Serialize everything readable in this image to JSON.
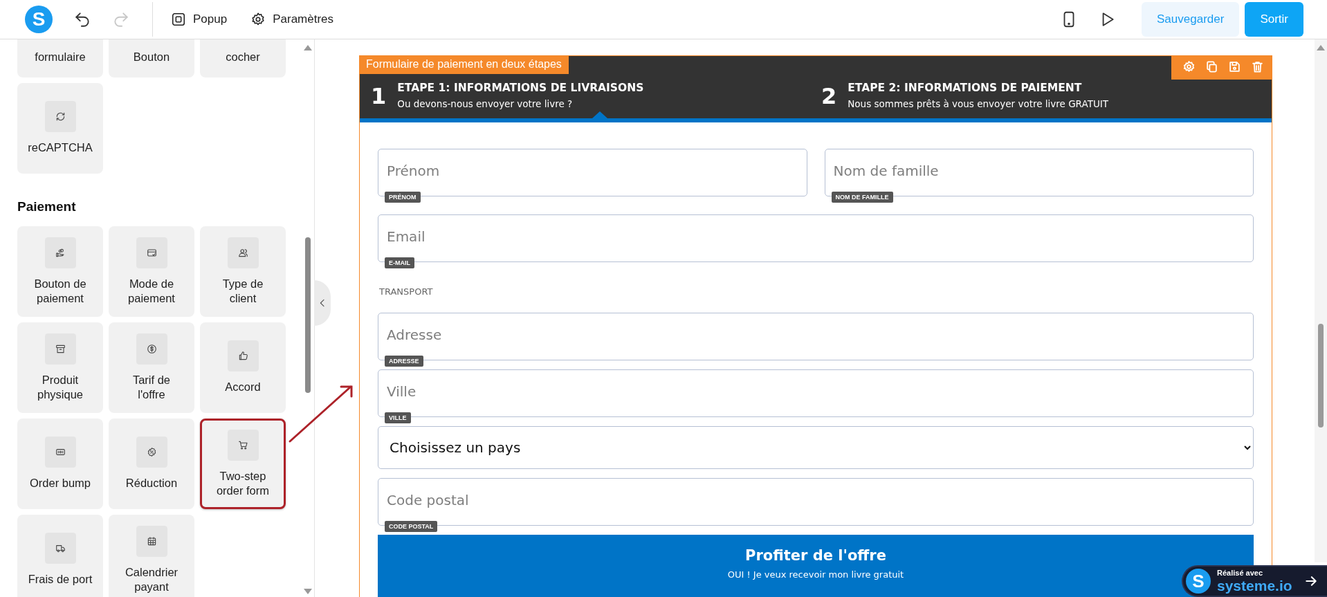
{
  "app": {
    "logo": "S"
  },
  "toolbar": {
    "history": [
      {
        "kind": "undo",
        "disabled": false
      },
      {
        "kind": "redo",
        "disabled": true
      }
    ],
    "menu": [
      {
        "label": "Popup",
        "kind": "popup"
      },
      {
        "label": "Paramètres",
        "kind": "gear"
      }
    ],
    "tools": [
      {
        "kind": "mobile"
      },
      {
        "kind": "play"
      }
    ],
    "buttons": [
      {
        "label": "Sauvegarder",
        "kind": "secondary"
      },
      {
        "label": "Sortir",
        "kind": "primary"
      }
    ]
  },
  "sidebar": {
    "sections": [
      {
        "items": [
          {
            "label": "formulaire",
            "highlighted": false
          },
          {
            "label": "Bouton",
            "highlighted": false
          },
          {
            "label": "cocher",
            "highlighted": false
          },
          {
            "label": "reCAPTCHA",
            "kind": "refresh",
            "highlighted": false
          }
        ]
      },
      {
        "title": "Paiement",
        "items": [
          {
            "label": "Bouton de\npaiement",
            "kind": "coins-hand",
            "highlighted": false
          },
          {
            "label": "Mode de\npaiement",
            "kind": "card",
            "highlighted": false
          },
          {
            "label": "Type de\nclient",
            "kind": "users",
            "highlighted": false
          },
          {
            "label": "Produit\nphysique",
            "kind": "archive",
            "highlighted": false
          },
          {
            "label": "Tarif de\nl'offre",
            "kind": "dollar",
            "highlighted": false
          },
          {
            "label": "Accord",
            "kind": "thumb",
            "highlighted": false
          },
          {
            "label": "Order bump",
            "kind": "ticket",
            "highlighted": false
          },
          {
            "label": "Réduction",
            "kind": "percent-badge",
            "highlighted": false
          },
          {
            "label": "Two-step\norder form",
            "kind": "cart",
            "highlighted": true
          },
          {
            "label": "Frais de port",
            "kind": "truck",
            "highlighted": false
          },
          {
            "label": "Calendrier\npayant",
            "kind": "calendar",
            "highlighted": false
          }
        ]
      }
    ]
  },
  "canvas": {
    "form": {
      "editor_label": "Formulaire de paiement en deux étapes",
      "actions": [
        {
          "kind": "gear"
        },
        {
          "kind": "copy"
        },
        {
          "kind": "save"
        },
        {
          "kind": "trash"
        }
      ],
      "steps": [
        {
          "number": "1",
          "title": "ETAPE 1: INFORMATIONS DE LIVRAISONS",
          "subtitle": "Ou devons-nous envoyer votre livre ?",
          "selected": true
        },
        {
          "number": "2",
          "title": "ETAPE 2: INFORMATIONS DE PAIEMENT",
          "subtitle": "Nous sommes prêts à vous envoyer votre livre GRATUIT",
          "selected": false
        }
      ],
      "rows": [
        {
          "kind": "fields",
          "fields": [
            {
              "placeholder": "Prénom",
              "tag": "PRÉNOM"
            },
            {
              "placeholder": "Nom de famille",
              "tag": "NOM DE FAMILLE"
            }
          ]
        },
        {
          "kind": "fields",
          "fields": [
            {
              "placeholder": "Email",
              "tag": "E-MAIL"
            }
          ]
        },
        {
          "kind": "heading",
          "text": "TRANSPORT"
        },
        {
          "kind": "fields",
          "fields": [
            {
              "placeholder": "Adresse",
              "tag": "ADRESSE"
            }
          ]
        },
        {
          "kind": "fields",
          "fields": [
            {
              "placeholder": "Ville",
              "tag": "VILLE"
            }
          ]
        },
        {
          "kind": "select",
          "value": "Choisissez un pays"
        },
        {
          "kind": "fields",
          "fields": [
            {
              "placeholder": "Code postal",
              "tag": "CODE POSTAL"
            }
          ]
        }
      ],
      "submit": {
        "title": "Profiter de l'offre",
        "subtitle": "OUI ! Je veux recevoir mon livre gratuit"
      }
    }
  },
  "badge": {
    "logo": "S",
    "caption": "Réalisé avec",
    "brand": "systeme.io"
  }
}
